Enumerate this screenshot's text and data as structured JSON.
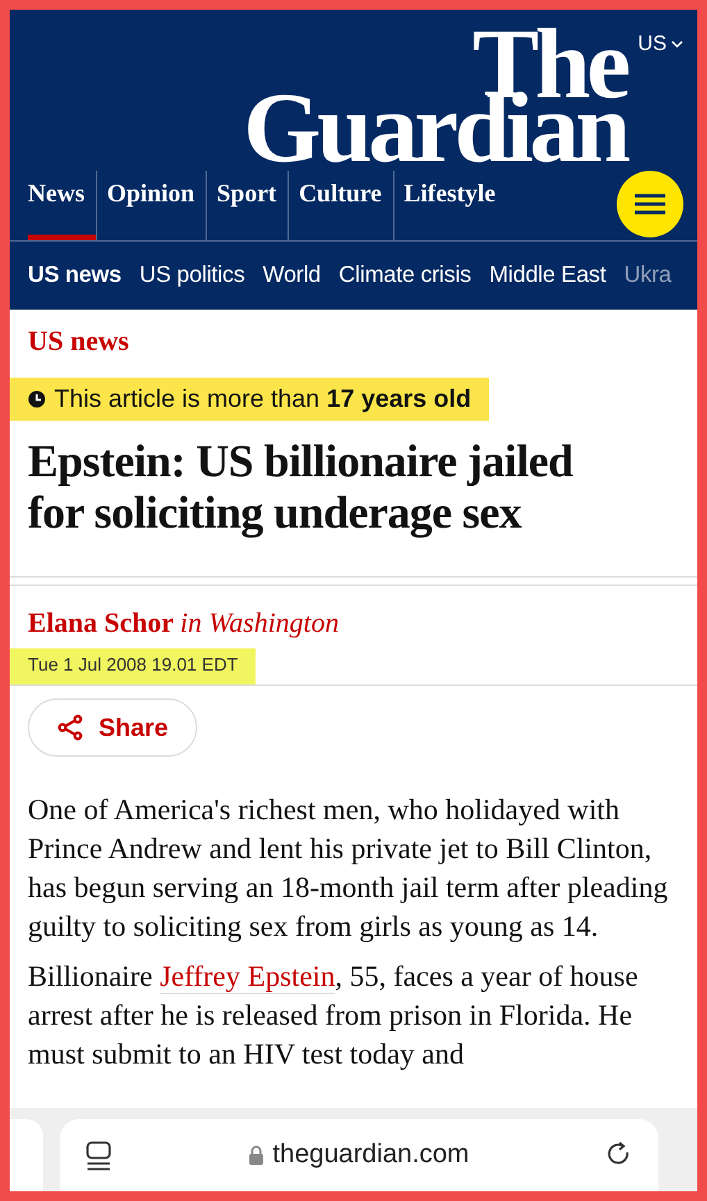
{
  "header": {
    "edition": "US",
    "logo": [
      "The",
      "Guardian"
    ],
    "pillars": [
      {
        "label": "News",
        "selected": true
      },
      {
        "label": "Opinion",
        "selected": false
      },
      {
        "label": "Sport",
        "selected": false
      },
      {
        "label": "Culture",
        "selected": false
      },
      {
        "label": "Lifestyle",
        "selected": false
      }
    ],
    "subnav": [
      {
        "label": "US news",
        "selected": true
      },
      {
        "label": "US politics",
        "selected": false
      },
      {
        "label": "World",
        "selected": false
      },
      {
        "label": "Climate crisis",
        "selected": false
      },
      {
        "label": "Middle East",
        "selected": false
      },
      {
        "label": "Ukra",
        "selected": false
      }
    ]
  },
  "article": {
    "section": "US news",
    "age_notice": {
      "text": "This article is more than **17 years old**",
      "highlighted": true
    },
    "headline": "Epstein: US billionaire jailed for soliciting underage sex",
    "byline": {
      "author": "Elana Schor",
      "location": "in Washington"
    },
    "date": {
      "text": "Tue 1 Jul 2008 19.01 EDT",
      "highlighted": true
    },
    "share": "Share",
    "paragraphs": [
      [
        {
          "kind": "text",
          "text": "One of America's richest men, who holidayed with Prince Andrew and lent his private jet to Bill Clinton, has begun serving an 18-month jail term after pleading guilty to soliciting sex from girls as young as 14."
        }
      ],
      [
        {
          "kind": "text",
          "text": "Billionaire "
        },
        {
          "kind": "link",
          "text": "Jeffrey Epstein"
        },
        {
          "kind": "text",
          "text": ", 55, faces a year of house arrest after he is released from prison in Florida. He must submit to an HIV test today and"
        }
      ]
    ]
  },
  "browser": {
    "url": "theguardian.com"
  }
}
